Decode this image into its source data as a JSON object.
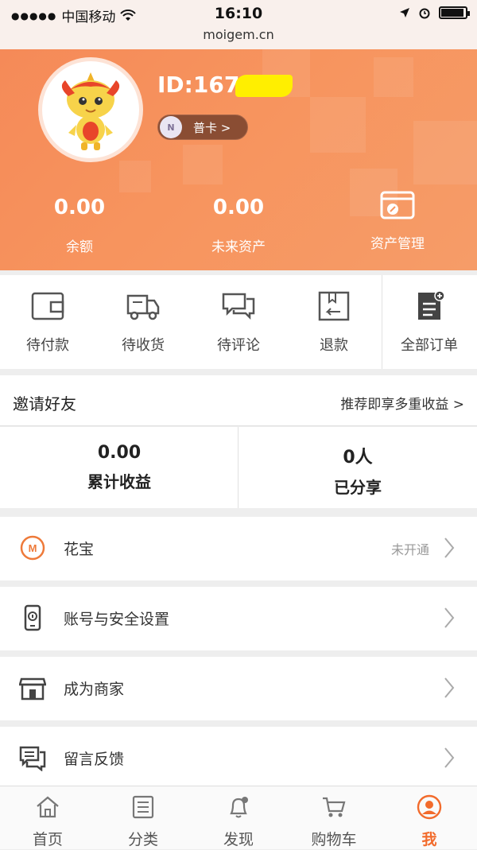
{
  "status_bar": {
    "carrier": "中国移动",
    "time": "16:10",
    "url": "moigem.cn"
  },
  "profile": {
    "id_label": "ID:1678",
    "card_label": "普卡 >",
    "stats": [
      {
        "value": "0.00",
        "label": "余额"
      },
      {
        "value": "0.00",
        "label": "未来资产"
      },
      {
        "value": "",
        "label": "资产管理"
      }
    ]
  },
  "orders": [
    {
      "label": "待付款",
      "icon": "wallet-icon"
    },
    {
      "label": "待收货",
      "icon": "truck-icon"
    },
    {
      "label": "待评论",
      "icon": "chat-icon"
    },
    {
      "label": "退款",
      "icon": "refund-box-icon"
    },
    {
      "label": "全部订单",
      "icon": "all-orders-icon"
    }
  ],
  "invite": {
    "title": "邀请好友",
    "link": "推荐即享多重收益 >",
    "stats": [
      {
        "value": "0.00",
        "label": "累计收益"
      },
      {
        "value": "0人",
        "label": "已分享"
      }
    ]
  },
  "menu": [
    {
      "label": "花宝",
      "status": "未开通",
      "icon": "huabao-logo-icon"
    },
    {
      "label": "账号与安全设置",
      "status": "",
      "icon": "phone-security-icon"
    },
    {
      "label": "成为商家",
      "status": "",
      "icon": "shop-icon"
    },
    {
      "label": "留言反馈",
      "status": "",
      "icon": "feedback-icon"
    }
  ],
  "tabs": [
    {
      "label": "首页",
      "icon": "home-icon"
    },
    {
      "label": "分类",
      "icon": "list-icon"
    },
    {
      "label": "发现",
      "icon": "bell-icon"
    },
    {
      "label": "购物车",
      "icon": "cart-icon"
    },
    {
      "label": "我",
      "icon": "user-icon",
      "active": true
    }
  ],
  "colors": {
    "accent": "#f26b2c",
    "hero": "#f7945e"
  }
}
